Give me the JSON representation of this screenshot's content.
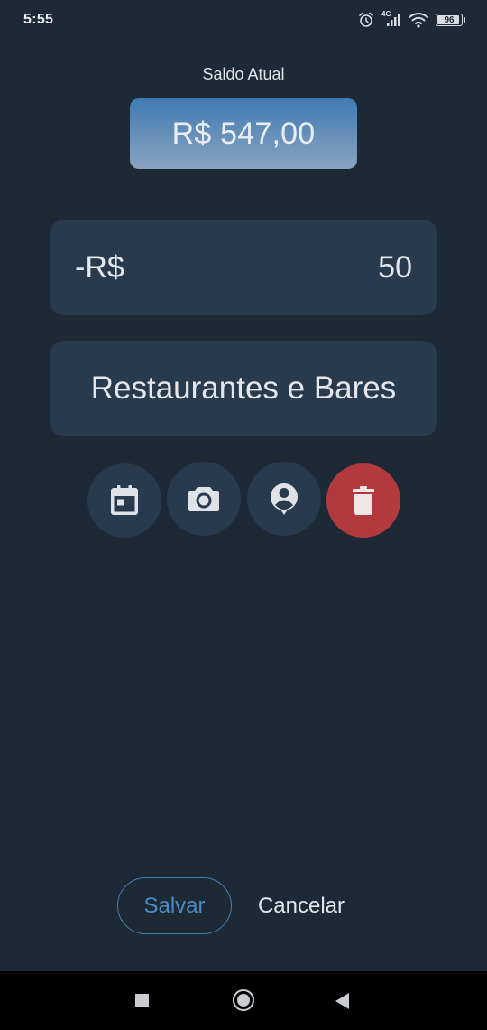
{
  "status_bar": {
    "time": "5:55",
    "network": "4G",
    "battery": "96",
    "icons": [
      "alarm-icon",
      "signal-icon",
      "wifi-icon",
      "battery-icon"
    ]
  },
  "balance": {
    "label": "Saldo Atual",
    "value": "R$ 547,00"
  },
  "amount": {
    "prefix": "-R$",
    "value": "50"
  },
  "category": {
    "label": "Restaurantes e Bares"
  },
  "actions": [
    {
      "name": "calendar-icon"
    },
    {
      "name": "camera-icon"
    },
    {
      "name": "contact-icon"
    },
    {
      "name": "trash-icon"
    }
  ],
  "buttons": {
    "save": "Salvar",
    "cancel": "Cancelar"
  },
  "colors": {
    "background": "#1e2936",
    "field": "#283a4d",
    "accent": "#3f7fb8",
    "danger": "#b23a3e"
  }
}
